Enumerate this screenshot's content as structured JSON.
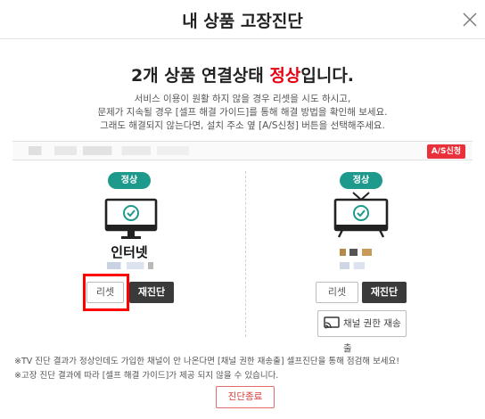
{
  "header": {
    "title": "내 상품 고장진단"
  },
  "headline": {
    "prefix": "2개 상품 연결상태 ",
    "status": "정상",
    "suffix": "입니다."
  },
  "description": [
    "서비스 이용이 원활 하지 않을 경우 리셋을 시도 하시고,",
    "문제가 지속될 경우 [셀프 해결 가이드]를 통해 해결 방법을 확인해 보세요.",
    "그래도 해결되지 않는다면, 설치 주소 옆 [A/S신청] 버튼을 선택해주세요."
  ],
  "info_bar": {
    "as_button": "A/S신청"
  },
  "devices": [
    {
      "status": "정상",
      "name": "인터넷",
      "reset_label": "리셋",
      "rediagnose_label": "재진단",
      "icon": "monitor-check-icon"
    },
    {
      "status": "정상",
      "reset_label": "리셋",
      "rediagnose_label": "재진단",
      "cast_label": "채널 권한 재송출",
      "icon": "tv-check-icon"
    }
  ],
  "notes": [
    "※TV 진단 결과가 정상인데도 가입한 채널이 안 나온다면 [채널 권한 재송출] 셀프진단을 통해 점검해 보세요!",
    "※고장 진단 결과에 따라 [셀프 해결 가이드]가 제공 되지 않을 수 있습니다."
  ],
  "footer": {
    "end_label": "진단종료"
  },
  "colors": {
    "accent_red": "#e60012",
    "status_teal": "#1e9a8c",
    "dark_button": "#3a3a3a",
    "highlight": "#ff0000"
  }
}
